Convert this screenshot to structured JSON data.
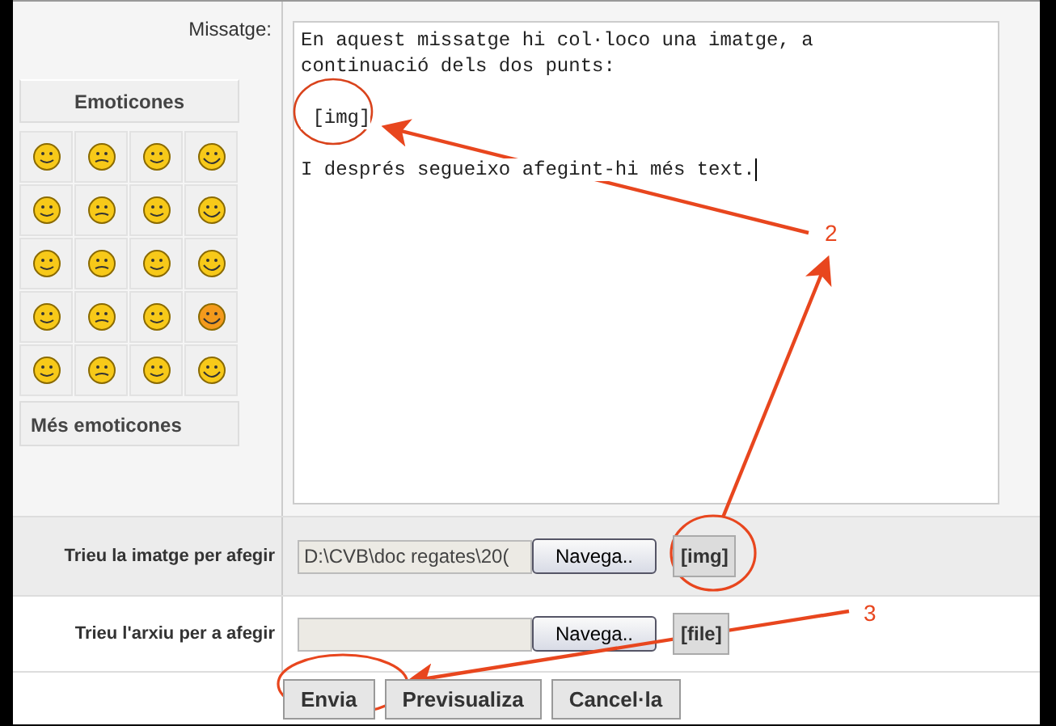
{
  "message_label": "Missatge:",
  "emoticons": {
    "title": "Emoticones",
    "more": "Més emoticones"
  },
  "message_paragraphs": [
    [
      "En aquest missatge hi col·loco una imatge, a",
      "continuació dels dos punts:"
    ],
    [
      " [img]"
    ],
    [
      "I després segueixo afegint-hi més text."
    ]
  ],
  "upload_rows": [
    {
      "label": "Trieu la imatge per afegir",
      "value": "D:\\CVB\\doc regates\\20(",
      "browse": "Navega..",
      "insert": "[img]",
      "shaded": true
    },
    {
      "label": "Trieu l'arxiu per a afegir",
      "browse": "Navega..",
      "insert": "[file]",
      "shaded": false
    }
  ],
  "buttons": [
    "Envia",
    "Previsualiza",
    "Cancel·la"
  ],
  "annotations": [
    "2",
    "3"
  ]
}
